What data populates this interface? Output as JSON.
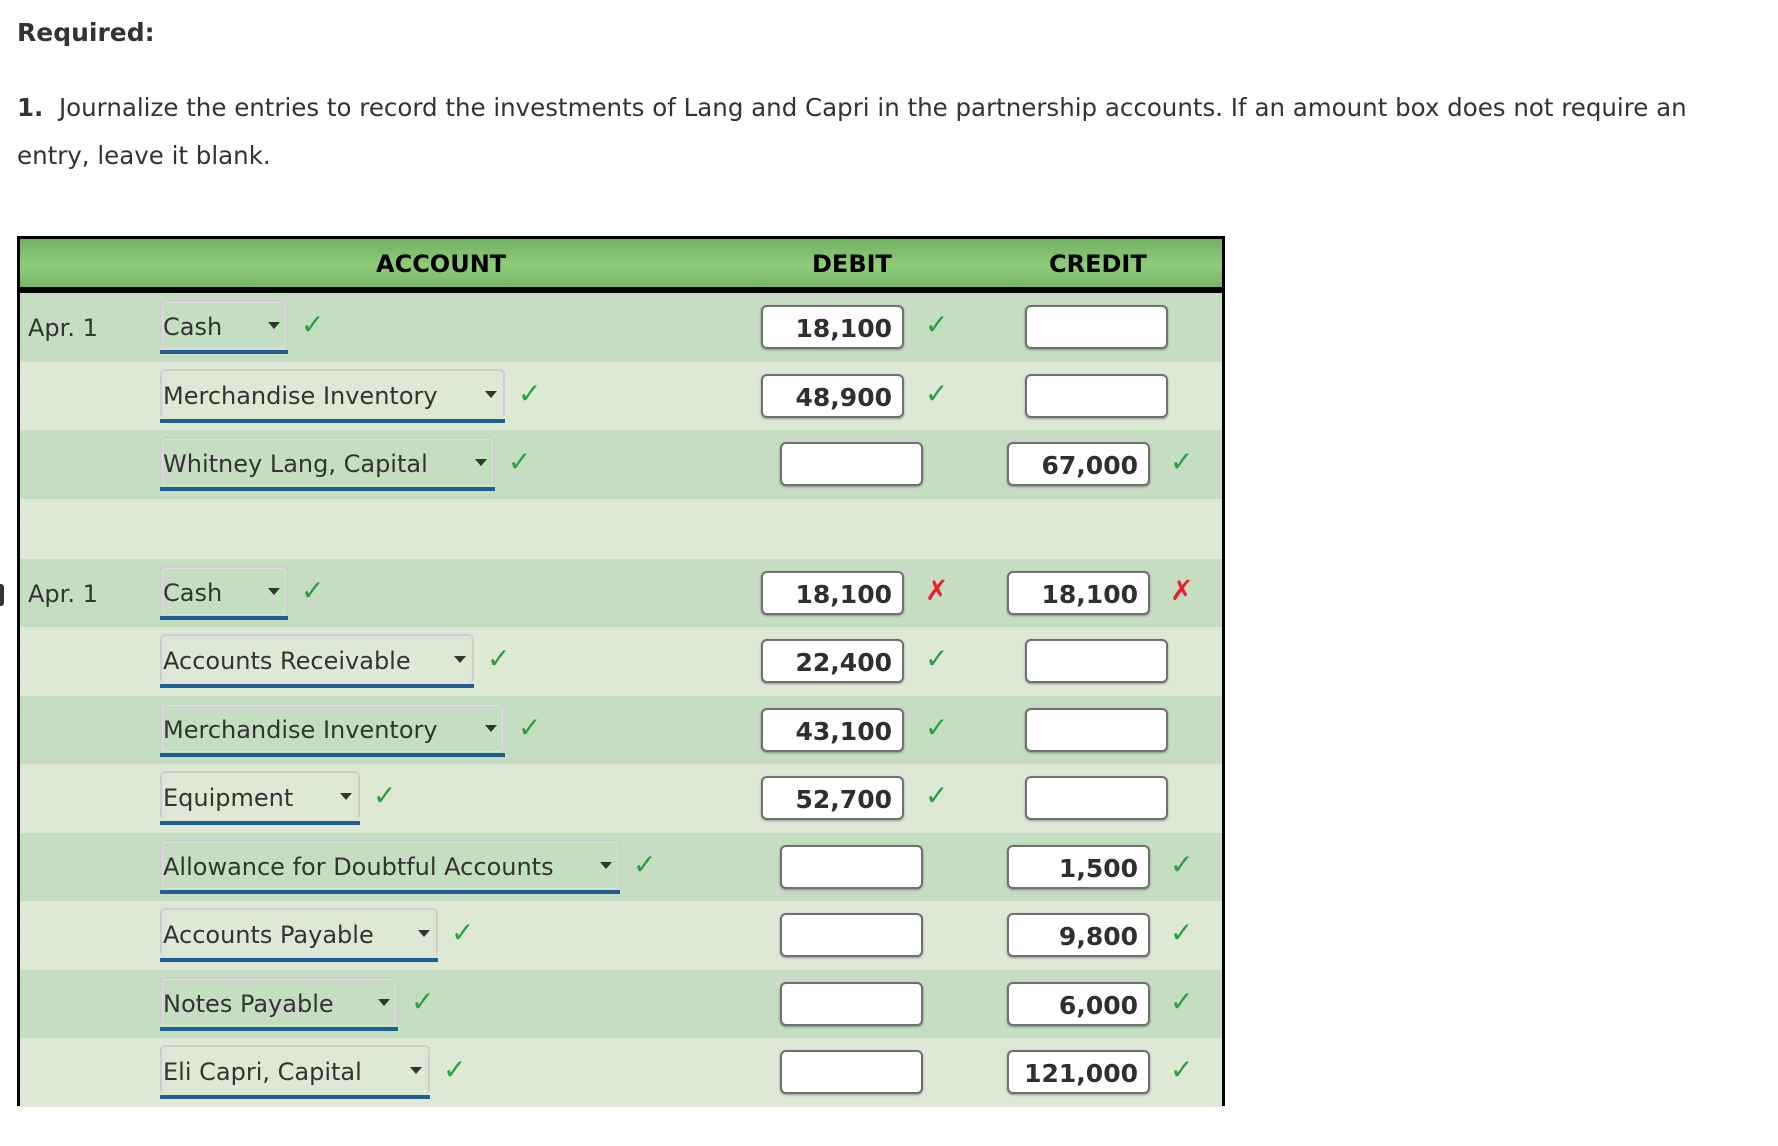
{
  "heading": "Required:",
  "instruction": {
    "number": "1.",
    "text": "Journalize the entries to record the investments of Lang and Capri in the partnership accounts. If an amount box does not require an entry, leave it blank."
  },
  "table": {
    "headers": {
      "account": "ACCOUNT",
      "debit": "DEBIT",
      "credit": "CREDIT"
    },
    "entries": [
      {
        "date": "Apr. 1",
        "lines": [
          {
            "account": "Cash",
            "account_status": "correct",
            "debit": "18,100",
            "debit_status": "correct",
            "credit": "",
            "credit_status": ""
          },
          {
            "account": "Merchandise Inventory",
            "account_status": "correct",
            "debit": "48,900",
            "debit_status": "correct",
            "credit": "",
            "credit_status": ""
          },
          {
            "account": "Whitney Lang, Capital",
            "account_status": "correct",
            "debit": "",
            "debit_status": "",
            "credit": "67,000",
            "credit_status": "correct"
          }
        ]
      },
      {
        "date": "Apr. 1",
        "lines": [
          {
            "account": "Cash",
            "account_status": "correct",
            "debit": "18,100",
            "debit_status": "incorrect",
            "credit": "18,100",
            "credit_status": "incorrect"
          },
          {
            "account": "Accounts Receivable",
            "account_status": "correct",
            "debit": "22,400",
            "debit_status": "correct",
            "credit": "",
            "credit_status": ""
          },
          {
            "account": "Merchandise Inventory",
            "account_status": "correct",
            "debit": "43,100",
            "debit_status": "correct",
            "credit": "",
            "credit_status": ""
          },
          {
            "account": "Equipment",
            "account_status": "correct",
            "debit": "52,700",
            "debit_status": "correct",
            "credit": "",
            "credit_status": ""
          },
          {
            "account": "Allowance for Doubtful Accounts",
            "account_status": "correct",
            "debit": "",
            "debit_status": "",
            "credit": "1,500",
            "credit_status": "correct"
          },
          {
            "account": "Accounts Payable",
            "account_status": "correct",
            "debit": "",
            "debit_status": "",
            "credit": "9,800",
            "credit_status": "correct"
          },
          {
            "account": "Notes Payable",
            "account_status": "correct",
            "debit": "",
            "debit_status": "",
            "credit": "6,000",
            "credit_status": "correct"
          },
          {
            "account": "Eli Capri, Capital",
            "account_status": "correct",
            "debit": "",
            "debit_status": "",
            "credit": "121,000",
            "credit_status": "correct"
          }
        ]
      }
    ]
  },
  "icons": {
    "correct": "✓",
    "incorrect": "✗"
  },
  "colors": {
    "header_green": "#8fcb7a",
    "row_dark": "#c5ddc0",
    "row_light": "#dde9d4",
    "correct": "#2d9e44",
    "incorrect": "#e8202a",
    "select_underline": "#1f5e8e"
  }
}
